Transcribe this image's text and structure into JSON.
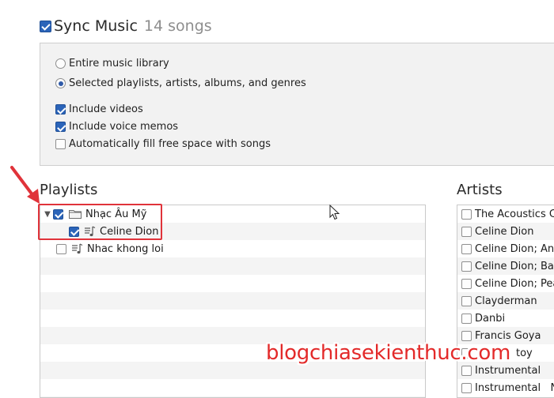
{
  "sync": {
    "title": "Sync Music",
    "count": "14 songs",
    "checked": true
  },
  "options": {
    "entire_library": "Entire music library",
    "selected": "Selected playlists, artists, albums, and genres",
    "include_videos": "Include videos",
    "include_voice_memos": "Include voice memos",
    "autofill": "Automatically fill free space with songs"
  },
  "playlists": {
    "title": "Playlists",
    "items": [
      {
        "label": "Nhạc Âu Mỹ",
        "checked": true,
        "type": "folder"
      },
      {
        "label": "Celine Dion",
        "checked": true,
        "type": "playlist"
      },
      {
        "label": "Nhac khong loi",
        "checked": false,
        "type": "playlist"
      }
    ]
  },
  "artists": {
    "title": "Artists",
    "items": [
      "The Acoustics Co",
      "Celine Dion",
      "Celine Dion; And",
      "Celine Dion; Barb",
      "Celine Dion; Peab",
      "Clayderman",
      "Danbi",
      "Francis Goya",
      "toy",
      "Instrumental",
      "Instrumental   Nl"
    ]
  },
  "watermark": "blogchiasekienthuc.com",
  "accent_color": "#2b64b9",
  "highlight_color": "#e0333a"
}
